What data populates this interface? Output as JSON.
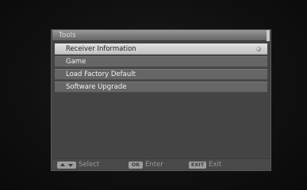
{
  "panel": {
    "title": "Tools"
  },
  "menu": {
    "items": [
      {
        "label": "Receiver Information",
        "selected": true
      },
      {
        "label": "Game",
        "selected": false
      },
      {
        "label": "Load Factory Default",
        "selected": false
      },
      {
        "label": "Software Upgrade",
        "selected": false
      }
    ]
  },
  "footer": {
    "select": {
      "key_icon": "up-down-arrows-icon",
      "label": "Select"
    },
    "enter": {
      "key_text": "OK",
      "label": "Enter"
    },
    "exit": {
      "key_text": "EXIT",
      "label": "Exit"
    }
  },
  "colors": {
    "panel_bg": "#444444",
    "selected_row": "#d0d0d0",
    "row_bg": "#666666"
  }
}
